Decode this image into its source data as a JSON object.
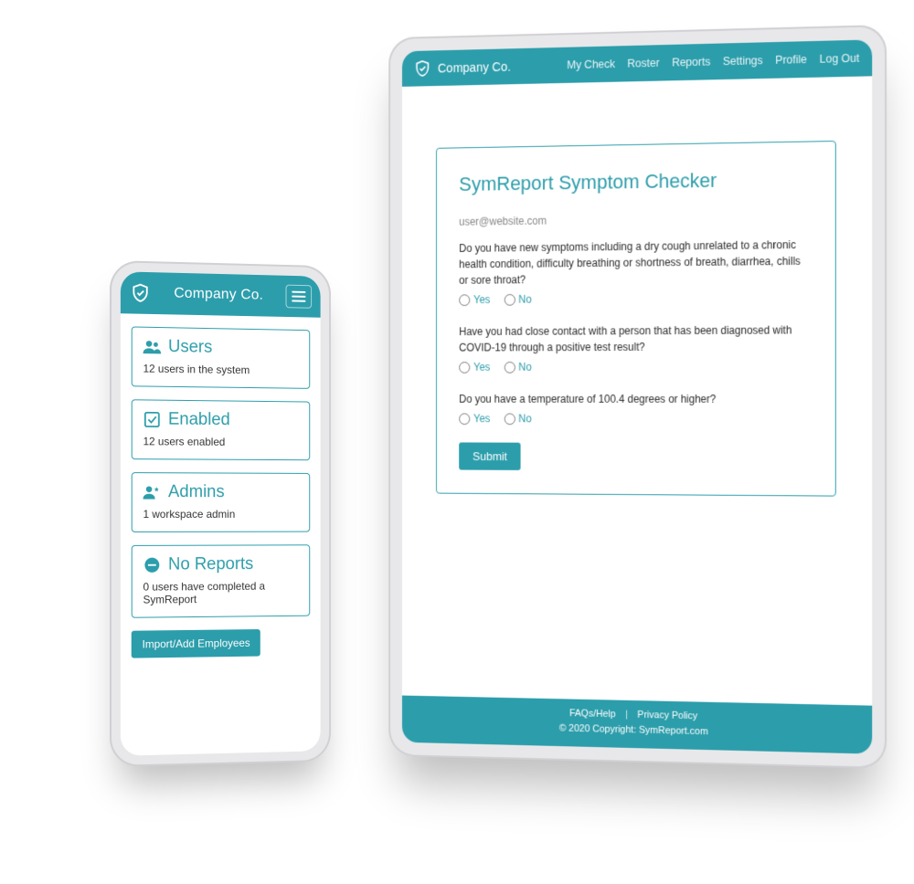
{
  "brand": "Company Co.",
  "phone": {
    "cards": [
      {
        "icon": "users-icon",
        "title": "Users",
        "sub": "12 users in the system"
      },
      {
        "icon": "check-icon",
        "title": "Enabled",
        "sub": "12 users enabled"
      },
      {
        "icon": "admins-icon",
        "title": "Admins",
        "sub": "1 workspace admin"
      },
      {
        "icon": "minus-icon",
        "title": "No Reports",
        "sub": "0 users have completed a SymReport"
      }
    ],
    "import_btn": "Import/Add Employees"
  },
  "tablet": {
    "nav": [
      "My Check",
      "Roster",
      "Reports",
      "Settings",
      "Profile",
      "Log Out"
    ],
    "form": {
      "heading": "SymReport Symptom Checker",
      "email": "user@website.com",
      "questions": [
        "Do you have new symptoms including a dry cough unrelated to a chronic health condition, difficulty breathing or shortness of breath, diarrhea, chills or sore throat?",
        "Have you had close contact with a person that has been diagnosed with COVID-19 through a positive test result?",
        "Do you have a temperature of 100.4 degrees or higher?"
      ],
      "yes": "Yes",
      "no": "No",
      "submit": "Submit"
    },
    "footer": {
      "faq": "FAQs/Help",
      "privacy": "Privacy Policy",
      "copyright": "© 2020 Copyright: SymReport.com"
    }
  }
}
